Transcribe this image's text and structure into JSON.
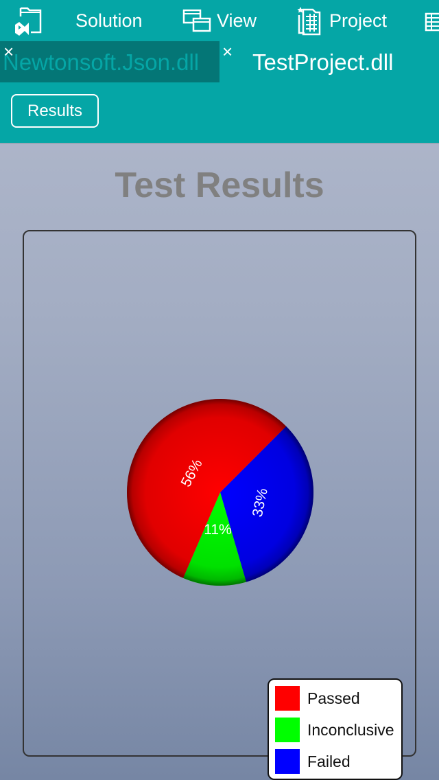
{
  "toolbar": {
    "items": [
      {
        "label": "Solution",
        "icon": "solution-icon"
      },
      {
        "label": "View",
        "icon": "view-icon"
      },
      {
        "label": "Project",
        "icon": "project-icon"
      },
      {
        "label": "",
        "icon": "overflow-icon"
      }
    ]
  },
  "tabs": [
    {
      "label": "Newtonsoft.Json.dll",
      "active": false,
      "close": "×"
    },
    {
      "label": "TestProject.dll",
      "active": true,
      "close": "×"
    }
  ],
  "results_button": {
    "label": "Results"
  },
  "page_title": "Test Results",
  "chart_data": {
    "type": "pie",
    "title": "Test Results",
    "categories": [
      "Passed",
      "Inconclusive",
      "Failed"
    ],
    "values": [
      56,
      11,
      33
    ],
    "unit": "%",
    "data_labels": [
      "56%",
      "11%",
      "33%"
    ],
    "colors": [
      "#ff0000",
      "#00ff00",
      "#0000ff"
    ],
    "legend": {
      "position": "bottom-right",
      "entries": [
        {
          "label": "Passed",
          "color": "#ff0000"
        },
        {
          "label": "Inconclusive",
          "color": "#00ff00"
        },
        {
          "label": "Failed",
          "color": "#0000ff"
        }
      ]
    }
  }
}
